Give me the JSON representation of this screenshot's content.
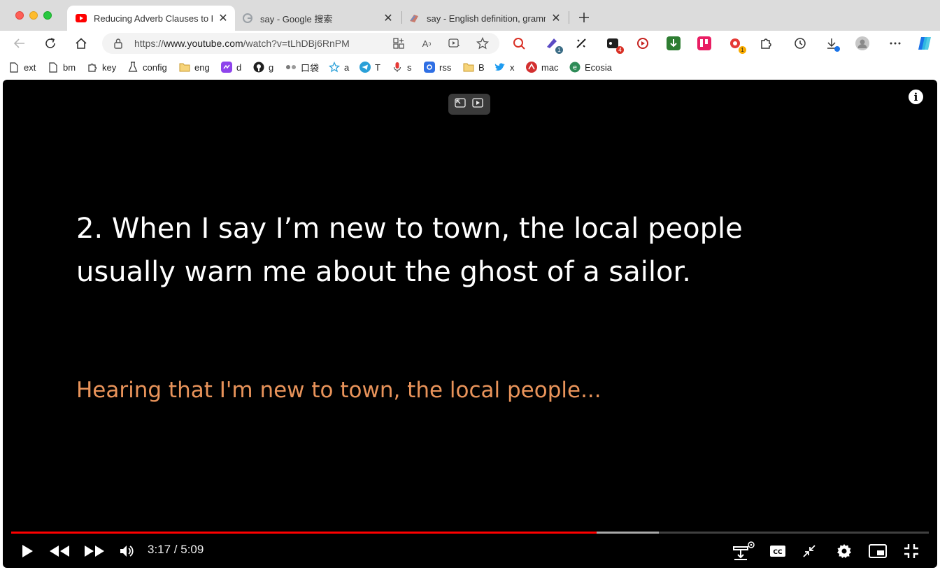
{
  "browser": {
    "tabs": [
      {
        "title": "Reducing Adverb Clauses to Phrases",
        "icon": "youtube-icon",
        "active": true
      },
      {
        "title": "say - Google 搜索",
        "icon": "google-icon",
        "active": false
      },
      {
        "title": "say - English definition, grammar",
        "icon": "dictionary-icon",
        "active": false
      }
    ],
    "url": {
      "scheme": "https://",
      "host": "www.youtube.com",
      "path": "/watch?v=tLhDBj6RnPM"
    },
    "extension_badges": {
      "ext_2": "1",
      "ext_4": "4",
      "ext_8": "1"
    },
    "bookmarks": [
      {
        "label": "ext",
        "icon": "page-icon"
      },
      {
        "label": "bm",
        "icon": "page-icon"
      },
      {
        "label": "key",
        "icon": "puzzle-icon"
      },
      {
        "label": "config",
        "icon": "flask-icon"
      },
      {
        "label": "eng",
        "icon": "folder-icon"
      },
      {
        "label": "d",
        "icon": "purple-app-icon"
      },
      {
        "label": "g",
        "icon": "github-icon"
      },
      {
        "label": "口袋",
        "icon": "pocket-icon"
      },
      {
        "label": "a",
        "icon": "star-outline-icon"
      },
      {
        "label": "T",
        "icon": "telegram-icon"
      },
      {
        "label": "s",
        "icon": "microphone-icon"
      },
      {
        "label": "rss",
        "icon": "rss-app-icon"
      },
      {
        "label": "B",
        "icon": "folder-icon"
      },
      {
        "label": "x",
        "icon": "twitter-icon"
      },
      {
        "label": "mac",
        "icon": "mac-app-icon"
      },
      {
        "label": "Ecosia",
        "icon": "ecosia-icon"
      }
    ]
  },
  "video": {
    "slide_line_1": "2. When I say I’m new to town, the local people",
    "slide_line_2": "usually warn me about the ghost of a sailor.",
    "slide_hint": "Hearing that I'm new to town, the local people...",
    "time": "3:17 / 5:09",
    "played_fraction": 0.638,
    "buffered_fraction": 0.706
  },
  "colors": {
    "progress": "#ff0000",
    "hint_text": "#e8935a",
    "accent": "#0b57d0"
  }
}
